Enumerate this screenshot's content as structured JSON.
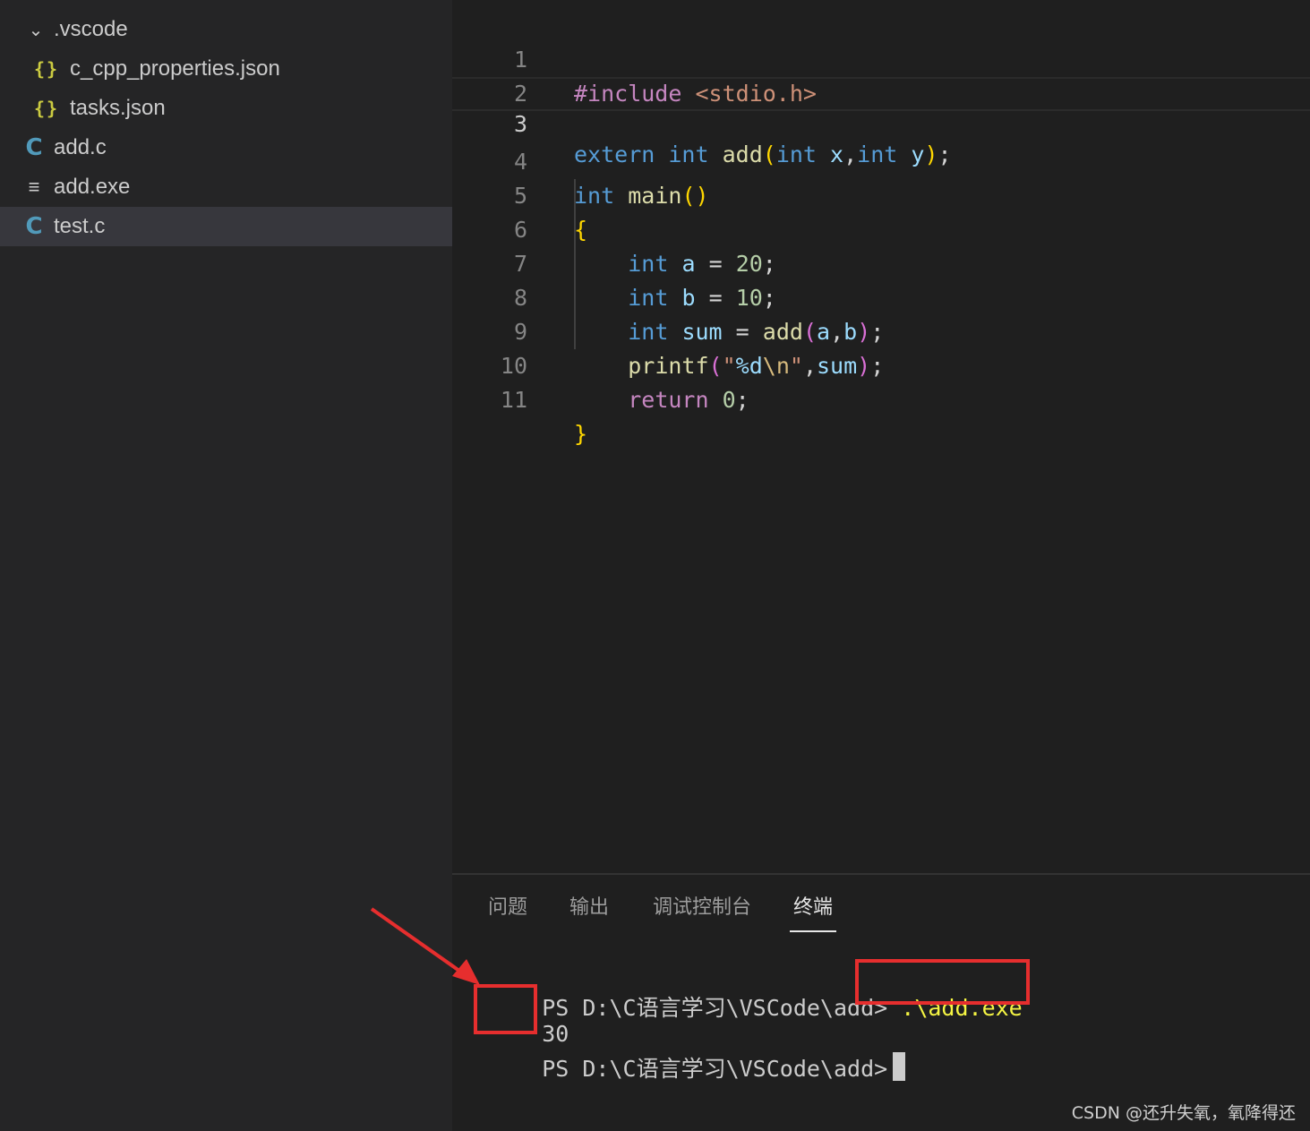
{
  "explorer": {
    "items": [
      {
        "label": ".vscode",
        "icon": "chevron-down-icon",
        "kind": "folder"
      },
      {
        "label": "c_cpp_properties.json",
        "icon": "json-file-icon",
        "glyph": "{}"
      },
      {
        "label": "tasks.json",
        "icon": "json-file-icon",
        "glyph": "{}"
      },
      {
        "label": "add.c",
        "icon": "c-file-icon",
        "glyph": "C"
      },
      {
        "label": "add.exe",
        "icon": "exe-file-icon",
        "glyph": "≡"
      },
      {
        "label": "test.c",
        "icon": "c-file-icon",
        "glyph": "C",
        "selected": true
      }
    ]
  },
  "editor": {
    "active_line": 3,
    "line_numbers": [
      "1",
      "2",
      "3",
      "4",
      "5",
      "6",
      "7",
      "8",
      "9",
      "10",
      "11"
    ]
  },
  "panel": {
    "tabs": [
      {
        "label": "问题"
      },
      {
        "label": "输出"
      },
      {
        "label": "调试控制台"
      },
      {
        "label": "终端",
        "active": true
      }
    ],
    "terminal": {
      "prompt1": "PS D:\\C语言学习\\VSCode\\add>",
      "command": ".\\add.exe",
      "output": "30",
      "prompt2": "PS D:\\C语言学习\\VSCode\\add>"
    }
  },
  "annotation_color": "#e62e2e",
  "watermark": "CSDN @还升失氧，氧降得还"
}
